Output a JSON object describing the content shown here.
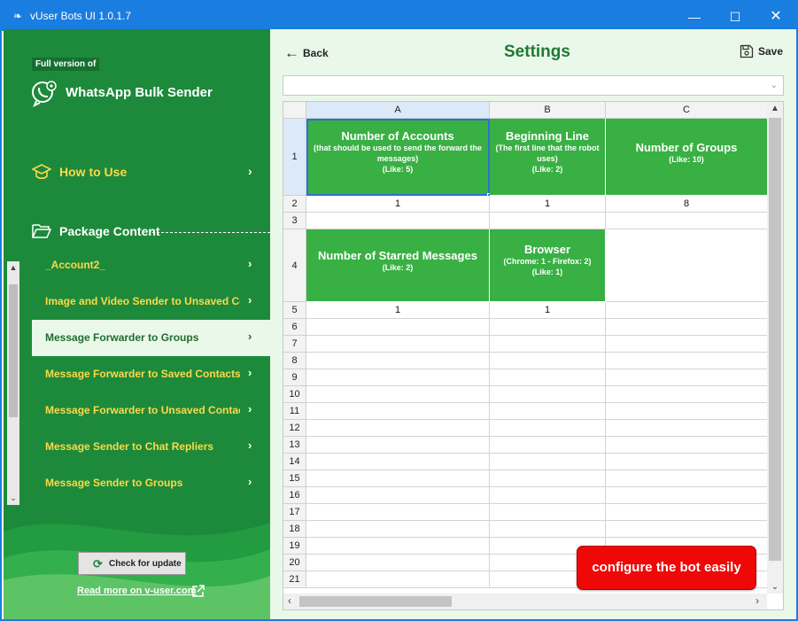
{
  "window": {
    "title": "vUser Bots UI 1.0.1.7",
    "minimize": "—",
    "maximize": "☐",
    "close": "✕",
    "border_color": "#1a7de0"
  },
  "sidebar": {
    "badge": "Full version of",
    "app_name": "WhatsApp Bulk Sender",
    "how_to_use": "How to Use",
    "package_content": "Package Content",
    "chevron": "›",
    "items": [
      {
        "label": "_Account2_",
        "active": false
      },
      {
        "label": "Image and Video Sender to Unsaved Conta",
        "active": false
      },
      {
        "label": "Message Forwarder to Groups",
        "active": true
      },
      {
        "label": "Message Forwarder to Saved Contacts",
        "active": false
      },
      {
        "label": "Message Forwarder to Unsaved Contacts",
        "active": false
      },
      {
        "label": "Message Sender to Chat Repliers",
        "active": false
      },
      {
        "label": "Message Sender to Groups",
        "active": false
      }
    ],
    "check_update": "Check for update",
    "read_more": "Read more on v-user.com",
    "bg_color": "#1c8a3a",
    "accent_color": "#ffd84a"
  },
  "main": {
    "back": "Back",
    "title": "Settings",
    "save": "Save",
    "dropdown_value": "",
    "dropdown_chevron": "⌄"
  },
  "sheet": {
    "columns": [
      "A",
      "B",
      "C"
    ],
    "rows": [
      "1",
      "2",
      "3",
      "4",
      "5",
      "6",
      "7",
      "8",
      "9",
      "10",
      "11",
      "12",
      "13",
      "14",
      "15",
      "16",
      "17",
      "18",
      "19",
      "20",
      "21"
    ],
    "headers_row1": [
      {
        "title": "Number of Accounts",
        "sub": "(that should be used to send the forward the messages)",
        "hint": "(Like: 5)"
      },
      {
        "title": "Beginning Line",
        "sub": "(The first line that the robot uses)",
        "hint": "(Like: 2)"
      },
      {
        "title": "Number of Groups",
        "sub": "",
        "hint": "(Like: 10)"
      }
    ],
    "values_row2": [
      "1",
      "1",
      "8"
    ],
    "headers_row4": [
      {
        "title": "Number of Starred Messages",
        "sub": "",
        "hint": "(Like: 2)"
      },
      {
        "title": "Browser",
        "sub": "(Chrome: 1 - Firefox: 2)",
        "hint": "(Like: 1)"
      }
    ],
    "values_row5": [
      "1",
      "1"
    ],
    "header_green": "#39b043"
  },
  "promo": {
    "text": "configure the bot easily",
    "color": "#ee0808"
  }
}
